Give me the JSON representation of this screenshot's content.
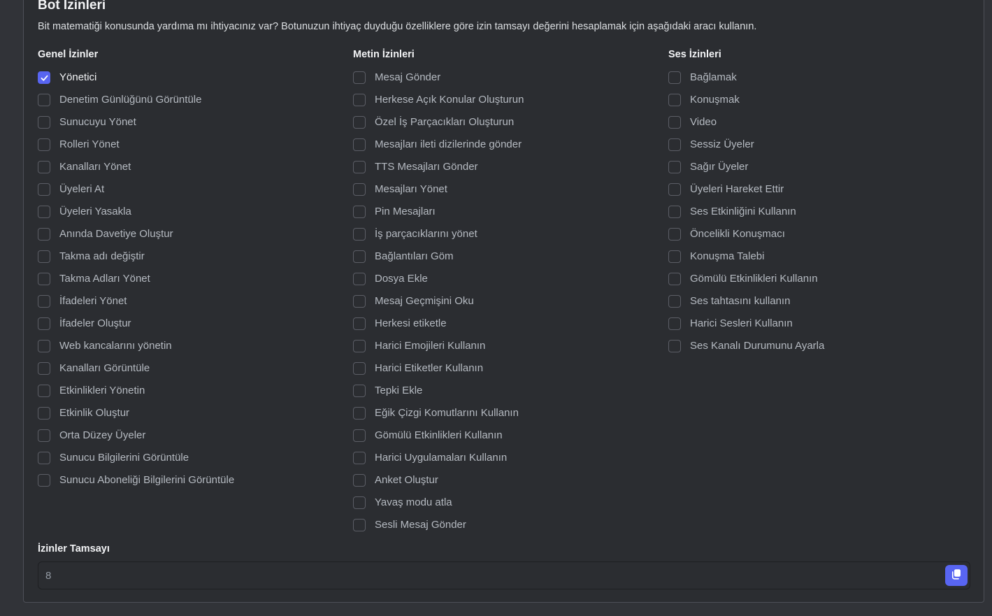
{
  "header": {
    "title": "Bot İzinleri",
    "description": "Bit matematiği konusunda yardıma mı ihtiyacınız var? Botunuzun ihtiyaç duyduğu özelliklere göre izin tamsayı değerini hesaplamak için aşağıdaki aracı kullanın."
  },
  "columns": [
    {
      "title": "Genel İzinler",
      "items": [
        {
          "label": "Yönetici",
          "checked": true
        },
        {
          "label": "Denetim Günlüğünü Görüntüle",
          "checked": false
        },
        {
          "label": "Sunucuyu Yönet",
          "checked": false
        },
        {
          "label": "Rolleri Yönet",
          "checked": false
        },
        {
          "label": "Kanalları Yönet",
          "checked": false
        },
        {
          "label": "Üyeleri At",
          "checked": false
        },
        {
          "label": "Üyeleri Yasakla",
          "checked": false
        },
        {
          "label": "Anında Davetiye Oluştur",
          "checked": false
        },
        {
          "label": "Takma adı değiştir",
          "checked": false
        },
        {
          "label": "Takma Adları Yönet",
          "checked": false
        },
        {
          "label": "İfadeleri Yönet",
          "checked": false
        },
        {
          "label": "İfadeler Oluştur",
          "checked": false
        },
        {
          "label": "Web kancalarını yönetin",
          "checked": false
        },
        {
          "label": "Kanalları Görüntüle",
          "checked": false
        },
        {
          "label": "Etkinlikleri Yönetin",
          "checked": false
        },
        {
          "label": "Etkinlik Oluştur",
          "checked": false
        },
        {
          "label": "Orta Düzey Üyeler",
          "checked": false
        },
        {
          "label": "Sunucu Bilgilerini Görüntüle",
          "checked": false
        },
        {
          "label": "Sunucu Aboneliği Bilgilerini Görüntüle",
          "checked": false
        }
      ]
    },
    {
      "title": "Metin İzinleri",
      "items": [
        {
          "label": "Mesaj Gönder",
          "checked": false
        },
        {
          "label": "Herkese Açık Konular Oluşturun",
          "checked": false
        },
        {
          "label": "Özel İş Parçacıkları Oluşturun",
          "checked": false
        },
        {
          "label": "Mesajları ileti dizilerinde gönder",
          "checked": false
        },
        {
          "label": "TTS Mesajları Gönder",
          "checked": false
        },
        {
          "label": "Mesajları Yönet",
          "checked": false
        },
        {
          "label": "Pin Mesajları",
          "checked": false
        },
        {
          "label": "İş parçacıklarını yönet",
          "checked": false
        },
        {
          "label": "Bağlantıları Göm",
          "checked": false
        },
        {
          "label": "Dosya Ekle",
          "checked": false
        },
        {
          "label": "Mesaj Geçmişini Oku",
          "checked": false
        },
        {
          "label": "Herkesi etiketle",
          "checked": false
        },
        {
          "label": "Harici Emojileri Kullanın",
          "checked": false
        },
        {
          "label": "Harici Etiketler Kullanın",
          "checked": false
        },
        {
          "label": "Tepki Ekle",
          "checked": false
        },
        {
          "label": "Eğik Çizgi Komutlarını Kullanın",
          "checked": false
        },
        {
          "label": "Gömülü Etkinlikleri Kullanın",
          "checked": false
        },
        {
          "label": "Harici Uygulamaları Kullanın",
          "checked": false
        },
        {
          "label": "Anket Oluştur",
          "checked": false
        },
        {
          "label": "Yavaş modu atla",
          "checked": false
        },
        {
          "label": "Sesli Mesaj Gönder",
          "checked": false
        }
      ]
    },
    {
      "title": "Ses İzinleri",
      "items": [
        {
          "label": "Bağlamak",
          "checked": false
        },
        {
          "label": "Konuşmak",
          "checked": false
        },
        {
          "label": "Video",
          "checked": false
        },
        {
          "label": "Sessiz Üyeler",
          "checked": false
        },
        {
          "label": "Sağır Üyeler",
          "checked": false
        },
        {
          "label": "Üyeleri Hareket Ettir",
          "checked": false
        },
        {
          "label": "Ses Etkinliğini Kullanın",
          "checked": false
        },
        {
          "label": "Öncelikli Konuşmacı",
          "checked": false
        },
        {
          "label": "Konuşma Talebi",
          "checked": false
        },
        {
          "label": "Gömülü Etkinlikleri Kullanın",
          "checked": false
        },
        {
          "label": "Ses tahtasını kullanın",
          "checked": false
        },
        {
          "label": "Harici Sesleri Kullanın",
          "checked": false
        },
        {
          "label": "Ses Kanalı Durumunu Ayarla",
          "checked": false
        }
      ]
    }
  ],
  "integer": {
    "label": "İzinler Tamsayı",
    "value": "8"
  },
  "colors": {
    "accent": "#5865f2",
    "panel_bg": "#2b2d31",
    "page_bg": "#313338"
  },
  "icons": {
    "checkbox_check": "checkmark-icon",
    "copy": "copy-icon"
  }
}
